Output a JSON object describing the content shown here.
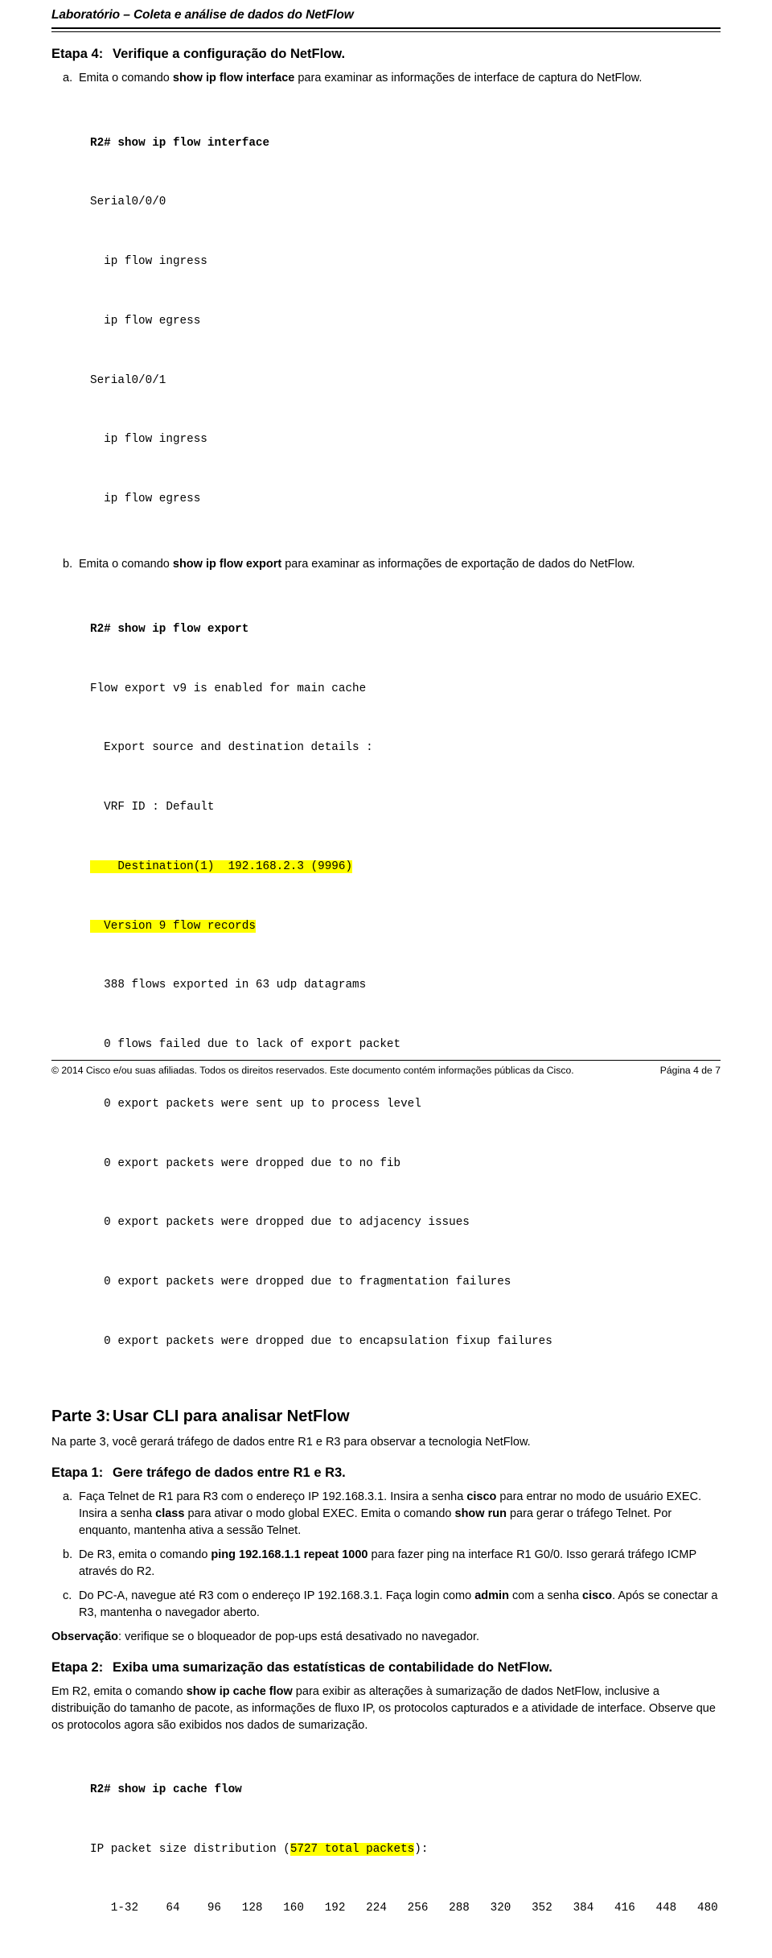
{
  "header": {
    "title": "Laboratório – Coleta e análise de dados do NetFlow"
  },
  "sections": {
    "step4": {
      "label": "Etapa 4:",
      "title": "Verifique a configuração do NetFlow.",
      "item_a": {
        "marker": "a.",
        "text_1": "Emita o comando ",
        "bold_1": "show ip flow interface",
        "text_2": " para examinar as informações de interface de captura do NetFlow."
      },
      "cli_a": {
        "prompt": "R2# ",
        "command": "show ip flow interface",
        "lines": [
          "Serial0/0/0",
          "  ip flow ingress",
          "  ip flow egress",
          "Serial0/0/1",
          "  ip flow ingress",
          "  ip flow egress"
        ]
      },
      "item_b": {
        "marker": "b.",
        "text_1": "Emita o comando ",
        "bold_1": "show ip flow export",
        "text_2": " para examinar as informações de exportação de dados do NetFlow."
      },
      "cli_b": {
        "prompt": "R2# ",
        "command": "show ip flow export",
        "line_1": "Flow export v9 is enabled for main cache",
        "line_2": "  Export source and destination details :",
        "line_3": "  VRF ID : Default",
        "line_4_highlight": "    Destination(1)  192.168.2.3 (9996)",
        "line_5_highlight": "  Version 9 flow records",
        "lines_rest": [
          "  388 flows exported in 63 udp datagrams",
          "  0 flows failed due to lack of export packet",
          "  0 export packets were sent up to process level",
          "  0 export packets were dropped due to no fib",
          "  0 export packets were dropped due to adjacency issues",
          "  0 export packets were dropped due to fragmentation failures",
          "  0 export packets were dropped due to encapsulation fixup failures"
        ]
      }
    },
    "part3": {
      "label": "Parte 3:",
      "title": "Usar CLI para analisar NetFlow",
      "intro": "Na parte 3, você gerará tráfego de dados entre R1 e R3 para observar a tecnologia NetFlow.",
      "step1": {
        "label": "Etapa 1:",
        "title": "Gere tráfego de dados entre R1 e R3.",
        "item_a": {
          "marker": "a.",
          "t1": "Faça Telnet de R1 para R3 com o endereço IP 192.168.3.1. Insira a senha ",
          "b1": "cisco",
          "t2": " para entrar no modo de usuário EXEC. Insira a senha ",
          "b2": "class",
          "t3": " para ativar o modo global EXEC. Emita o comando ",
          "b3": "show run",
          "t4": " para gerar o tráfego Telnet. Por enquanto, mantenha ativa a sessão Telnet."
        },
        "item_b": {
          "marker": "b.",
          "t1": "De R3, emita o comando ",
          "b1": "ping 192.168.1.1 repeat 1000",
          "t2": " para fazer ping na interface R1 G0/0. Isso gerará tráfego ICMP através do R2."
        },
        "item_c": {
          "marker": "c.",
          "t1": "Do PC-A, navegue até R3 com o endereço IP 192.168.3.1. Faça login como ",
          "b1": "admin",
          "t2": " com a senha ",
          "b2": "cisco",
          "t3": ". Após se conectar a R3, mantenha o navegador aberto."
        },
        "note": {
          "bold": "Observação",
          "text": ": verifique se o bloqueador de pop-ups está desativado no navegador."
        }
      },
      "step2": {
        "label": "Etapa 2:",
        "title": "Exiba uma sumarização das estatísticas de contabilidade do NetFlow.",
        "p1_t1": "Em R2, emita o comando ",
        "p1_b1": "show ip cache flow",
        "p1_t2": " para exibir as alterações à sumarização de dados NetFlow, inclusive a distribuição do tamanho de pacote, as informações de fluxo IP, os protocolos capturados e a atividade de interface. Observe que os protocolos agora são exibidos nos dados de sumarização.",
        "cli": {
          "prompt": "R2# ",
          "command": "show ip cache flow",
          "line_1_pre": "IP packet size distribution (",
          "line_1_hl": "5727 total packets",
          "line_1_post": "):",
          "line_2": "   1-32    64    96   128   160   192   224   256   288   320   352   384   416   448   480"
        }
      }
    }
  },
  "footer": {
    "copyright": "© 2014 Cisco e/ou suas afiliadas. Todos os direitos reservados. Este documento contém informações públicas da Cisco.",
    "page": "Página 4 de 7"
  }
}
